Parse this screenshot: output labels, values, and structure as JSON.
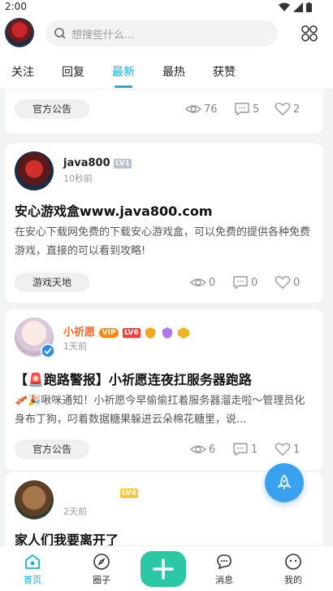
{
  "status_bar": {
    "time": "2:00"
  },
  "header": {
    "search_placeholder": "想搜些什么..."
  },
  "tabs": [
    "关注",
    "回复",
    "最新",
    "最热",
    "获赞"
  ],
  "posts": [
    {
      "tag": "官方公告",
      "views": "76",
      "comments": "5",
      "likes": "2"
    },
    {
      "username": "java800",
      "level": "LV1",
      "time": "10秒前",
      "title": "安心游戏盒www.java800.com",
      "body": "在安心下载网免费的下载安心游戏盒，可以免费的提供各种免费游戏，直接的可以看到攻略!",
      "tag": "游戏天地",
      "views": "0",
      "comments": "0",
      "likes": "0"
    },
    {
      "username": "小祈愿",
      "badge_vip": "VIP",
      "level": "LV6",
      "time": "1天前",
      "title": "【🚨跑路警报】小祈愿连夜扛服务器跑路",
      "body": "🥓🎉啾咪通知！小祈愿今早偷偷扛着服务器溜走啦～管理员化身布丁狗，叼着数据糖果躲进云朵棉花糖里，说...",
      "tag": "官方公告",
      "views": "6",
      "comments": "1",
      "likes": "1"
    },
    {
      "level": "LV4",
      "time": "2天前",
      "title": "家人们我要离开了"
    }
  ],
  "bottom_nav": [
    "首页",
    "圈子",
    "消息",
    "我的"
  ],
  "colors": {
    "accent": "#1db0d8",
    "plus": "#2cc7a4",
    "rocket": "#3aa1ef",
    "vip_name": "#ff6a2a"
  }
}
